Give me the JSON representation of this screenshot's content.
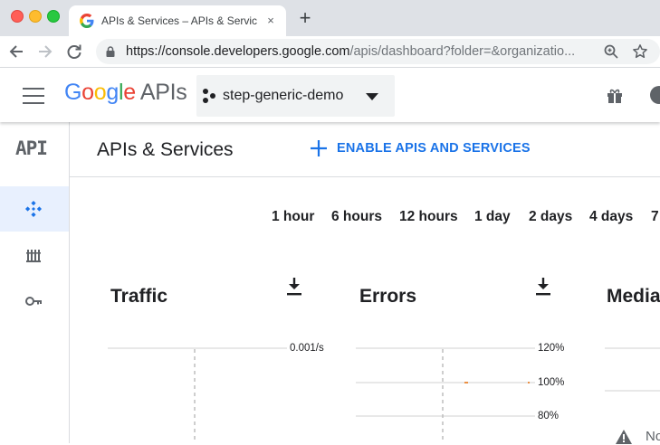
{
  "browser": {
    "tab_title": "APIs & Services – APIs & Services",
    "tab_close": "×",
    "new_tab": "+",
    "url_host": "https://console.developers.google.com",
    "url_path": "/apis/dashboard?folder=&organizatio..."
  },
  "header": {
    "logo": {
      "letters": [
        "G",
        "o",
        "o",
        "g",
        "l",
        "e"
      ],
      "letter_colors": [
        "#4285f4",
        "#ea4335",
        "#fbbc05",
        "#4285f4",
        "#34a853",
        "#ea4335"
      ],
      "suffix": "APIs"
    },
    "project_name": "step-generic-demo"
  },
  "sidebar": {
    "badge": "API",
    "items": [
      {
        "icon": "dashboard-diamond-icon",
        "active": true
      },
      {
        "icon": "library-icon",
        "active": false
      },
      {
        "icon": "key-icon",
        "active": false
      }
    ]
  },
  "page": {
    "title": "APIs & Services",
    "enable_button": "ENABLE APIS AND SERVICES"
  },
  "time_ranges": [
    "1 hour",
    "6 hours",
    "12 hours",
    "1 day",
    "2 days",
    "4 days",
    "7"
  ],
  "cards": {
    "traffic": {
      "title": "Traffic",
      "axis_labels": [
        "0.001/s"
      ]
    },
    "errors": {
      "title": "Errors",
      "axis_labels": [
        "120%",
        "100%",
        "80%"
      ]
    },
    "median_latency": {
      "title": "Media",
      "notice": "No"
    }
  },
  "colors": {
    "accent": "#1a73e8",
    "active_nav_bg": "#e8f0fe",
    "error_marker": "#e8710a"
  }
}
